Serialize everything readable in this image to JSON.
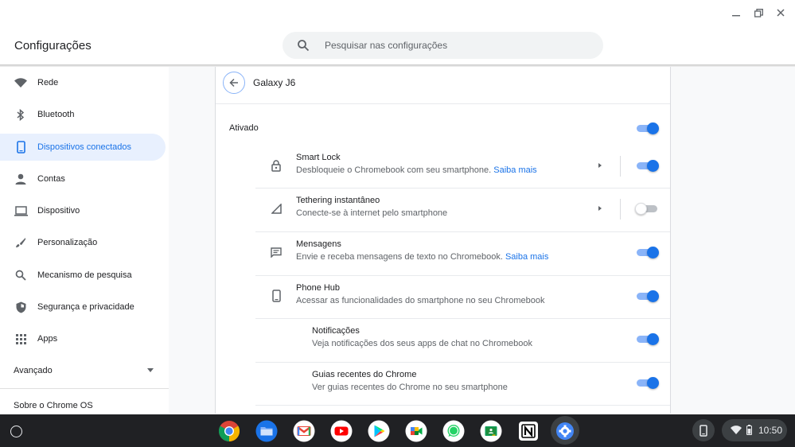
{
  "window": {
    "minimize_icon": "minimize-icon",
    "restore_icon": "restore-icon",
    "close_icon": "close-icon"
  },
  "header": {
    "title": "Configurações",
    "search_placeholder": "Pesquisar nas configurações"
  },
  "sidebar": {
    "items": [
      {
        "label": "Rede",
        "icon": "wifi-icon"
      },
      {
        "label": "Bluetooth",
        "icon": "bluetooth-icon"
      },
      {
        "label": "Dispositivos conectados",
        "icon": "phone-icon",
        "active": true
      },
      {
        "label": "Contas",
        "icon": "person-icon"
      },
      {
        "label": "Dispositivo",
        "icon": "laptop-icon"
      },
      {
        "label": "Personalização",
        "icon": "brush-icon"
      },
      {
        "label": "Mecanismo de pesquisa",
        "icon": "search-icon"
      },
      {
        "label": "Segurança e privacidade",
        "icon": "shield-icon"
      },
      {
        "label": "Apps",
        "icon": "apps-grid-icon"
      }
    ],
    "advanced": "Avançado",
    "about": "Sobre o Chrome OS"
  },
  "page": {
    "title": "Galaxy J6",
    "enabled_label": "Ativado",
    "enabled": true,
    "features": [
      {
        "title": "Smart Lock",
        "subtitle": "Desbloqueie o Chromebook com seu smartphone.",
        "link": "Saiba mais",
        "icon": "lock-icon",
        "enabled": true,
        "has_arrow": true
      },
      {
        "title": "Tethering instantâneo",
        "subtitle": "Conecte-se à internet pelo smartphone",
        "icon": "signal-icon",
        "enabled": false,
        "has_arrow": true
      },
      {
        "title": "Mensagens",
        "subtitle": "Envie e receba mensagens de texto no Chromebook.",
        "link": "Saiba mais",
        "icon": "message-icon",
        "enabled": true
      },
      {
        "title": "Phone Hub",
        "subtitle": "Acessar as funcionalidades do smartphone no seu Chromebook",
        "icon": "phone-icon",
        "enabled": true
      },
      {
        "title": "Notificações",
        "subtitle": "Veja notificações dos seus apps de chat no Chromebook",
        "enabled": true,
        "nested": true
      },
      {
        "title": "Guias recentes do Chrome",
        "subtitle": "Ver guias recentes do Chrome no seu smartphone",
        "enabled": true,
        "nested": true
      }
    ]
  },
  "shelf": {
    "apps": [
      "chrome-icon",
      "files-icon",
      "gmail-icon",
      "youtube-icon",
      "play-store-icon",
      "meet-icon",
      "whatsapp-icon",
      "classroom-icon",
      "notion-icon",
      "settings-icon"
    ],
    "time": "10:50"
  },
  "colors": {
    "accent": "#1a73e8",
    "accent_light": "#8ab4f8",
    "active_bg": "#e8f0fe",
    "shelf": "#202124"
  }
}
